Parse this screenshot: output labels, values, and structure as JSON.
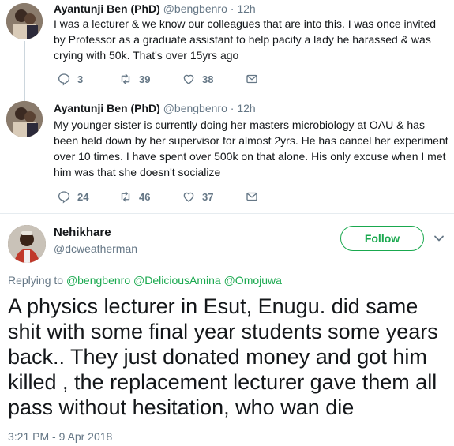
{
  "replies": [
    {
      "name": "Ayantunji Ben (PhD)",
      "handle": "@bengbenro",
      "time": "12h",
      "text": "I was a lecturer & we know our colleagues that are into this. I was once invited by Professor as a graduate assistant to help pacify a lady he harassed & was crying with 50k. That's over 15yrs ago",
      "reply_count": "3",
      "retweet_count": "39",
      "like_count": "38"
    },
    {
      "name": "Ayantunji Ben (PhD)",
      "handle": "@bengbenro",
      "time": "12h",
      "text": "My younger sister is currently doing her masters microbiology at OAU & has been held down by her supervisor for almost 2yrs. He has cancel her experiment over 10 times. I have spent over 500k on that alone. His only excuse when I met him was that she doesn't socialize",
      "reply_count": "24",
      "retweet_count": "46",
      "like_count": "37"
    }
  ],
  "main_tweet": {
    "name": "Nehikhare",
    "handle": "@dcweatherman",
    "follow_label": "Follow",
    "replying_prefix": "Replying to",
    "replying_to": [
      "@bengbenro",
      "@DeliciousAmina",
      "@Omojuwa"
    ],
    "text": "A physics lecturer in Esut, Enugu. did same shit with some final year students some years back.. They just donated money and got him killed , the replacement lecturer gave them all pass without hesitation, who wan die",
    "timestamp": "3:21 PM - 9 Apr 2018"
  },
  "colors": {
    "accent": "#19a84e",
    "muted": "#657786",
    "text": "#14171a",
    "divider": "#e6ecf0"
  },
  "icons": [
    "reply-icon",
    "retweet-icon",
    "like-icon",
    "direct-message-icon",
    "chevron-down-icon"
  ]
}
